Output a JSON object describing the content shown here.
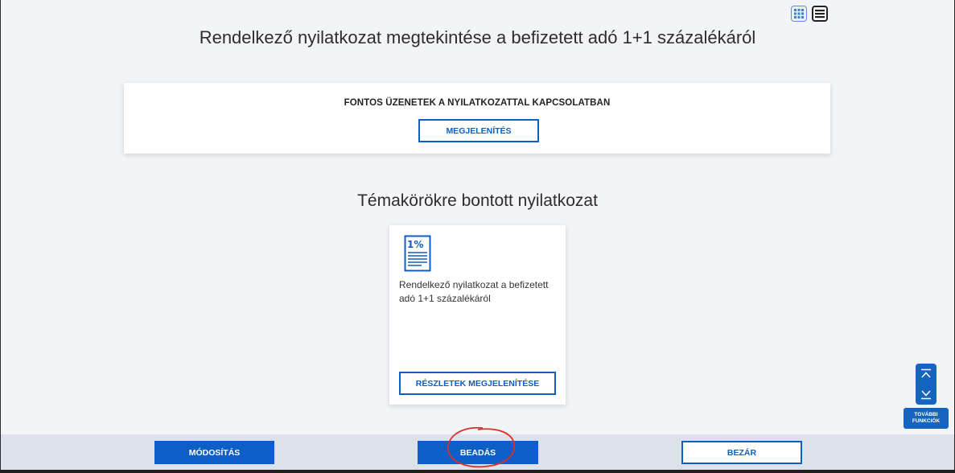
{
  "header": {
    "title": "Rendelkező nyilatkozat megtekintése a befizetett adó 1+1 százalékáról",
    "view_toggles": [
      {
        "icon": "grid-view-icon",
        "active": true
      },
      {
        "icon": "list-view-icon",
        "active": false
      }
    ]
  },
  "notice": {
    "title": "FONTOS ÜZENETEK A NYILATKOZATTAL KAPCSOLATBAN",
    "button_label": "MEGJELENÍTÉS"
  },
  "section": {
    "title": "Témakörökre bontott nyilatkozat"
  },
  "topic_card": {
    "icon": "one-percent-document-icon",
    "icon_text": "1%",
    "text": "Rendelkező nyilatkozat a befizetett adó 1+1 százalékáról",
    "button_label": "RÉSZLETEK MEGJELENÍTÉSE"
  },
  "side_panel": {
    "label": "TOVÁBBI FUNKCIÓK",
    "icons": [
      "scroll-top-icon",
      "scroll-bottom-icon"
    ]
  },
  "footer": {
    "modify_label": "MÓDOSÍTÁS",
    "submit_label": "BEADÁS",
    "close_label": "BEZÁR"
  },
  "colors": {
    "primary": "#0d5fc7",
    "background": "#f3f4f7",
    "footer_bg": "#dde1ea",
    "annotation": "#d9302b"
  }
}
